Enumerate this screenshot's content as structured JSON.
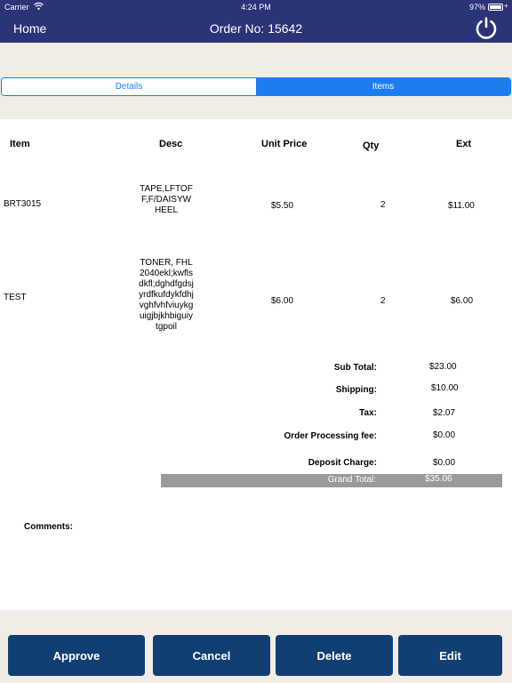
{
  "status_bar": {
    "carrier": "Carrier",
    "time": "4:24 PM",
    "battery": "97%",
    "battery_level": 0.97
  },
  "nav": {
    "home_label": "Home",
    "title": "Order No: 15642"
  },
  "tabs": [
    {
      "label": "Details",
      "selected": false
    },
    {
      "label": "Items",
      "selected": true
    }
  ],
  "table": {
    "headers": [
      "Item",
      "Desc",
      "Unit Price",
      "Qty",
      "Ext"
    ],
    "rows": [
      {
        "item": "BRT3015",
        "desc": "TAPE,LFTOFF,F/DAISYWHEEL",
        "unit_price": "$5.50",
        "qty": "2",
        "ext": "$11.00"
      },
      {
        "item": "TEST",
        "desc": "TONER, FHL2040ekl;kwflsdkfl;dghdfgdsjyrdfkufdykfdhjvghfvhfviuykguigjbjkhbiguiytgpoil",
        "unit_price": "$6.00",
        "qty": "2",
        "ext": "$6.00"
      }
    ]
  },
  "totals": {
    "subtotal_label": "Sub Total:",
    "subtotal": "$23.00",
    "shipping_label": "Shipping:",
    "shipping": "$10.00",
    "tax_label": "Tax:",
    "tax": "$2.07",
    "processing_label": "Order Processing fee:",
    "processing": "$0.00",
    "deposit_label": "Deposit Charge:",
    "deposit": "$0.00",
    "grand_label": "Grand Total:",
    "grand": "$35.06"
  },
  "comments_label": "Comments:",
  "buttons": {
    "approve": "Approve",
    "cancel": "Cancel",
    "delete": "Delete",
    "edit": "Edit"
  },
  "colors": {
    "nav": "#2c3478",
    "accent": "#1e7cf3",
    "button": "#123f73",
    "band": "#f1ede6",
    "grand_bar": "#9a9a9a"
  },
  "icons": {
    "power": "power-icon",
    "wifi": "wifi-icon",
    "battery": "battery-icon"
  }
}
